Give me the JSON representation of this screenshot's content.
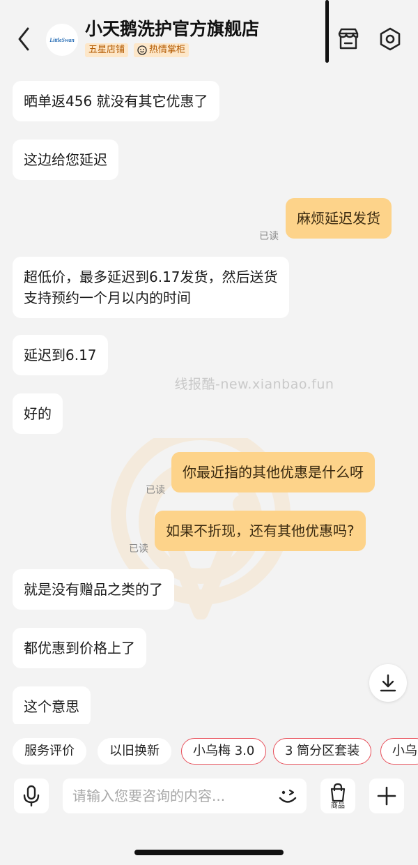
{
  "header": {
    "shop_name": "小天鹅洗护官方旗舰店",
    "logo_text": "LittleSwan",
    "badge_rating": "五星店铺",
    "badge_service": "热情掌柜",
    "icons": [
      "chevron-left-icon",
      "store-icon",
      "settings-icon"
    ]
  },
  "messages": [
    {
      "side": "in",
      "text": "晒单返456   就没有其它优惠了"
    },
    {
      "side": "in",
      "text": "这边给您延迟"
    },
    {
      "side": "out",
      "text": "麻烦延迟发货",
      "status": "已读"
    },
    {
      "side": "in",
      "text": "超低价，最多延迟到6.17发货，然后送货",
      "text2": "支持预约一个月以内的时间"
    },
    {
      "side": "in",
      "text": "延迟到6.17"
    },
    {
      "side": "in",
      "text": "好的"
    },
    {
      "side": "out",
      "text": "你最近指的其他优惠是什么呀",
      "status": "已读"
    },
    {
      "side": "out",
      "text": "如果不折现，还有其他优惠吗?",
      "status": "已读"
    },
    {
      "side": "in",
      "text": "就是没有赠品之类的了"
    },
    {
      "side": "in",
      "text": "都优惠到价格上了"
    },
    {
      "side": "in",
      "text": "这个意思"
    }
  ],
  "watermark": "线报酷-new.xianbao.fun",
  "quick_chips": [
    {
      "label": "服务评价",
      "style": "plain"
    },
    {
      "label": "以旧换新",
      "style": "plain"
    },
    {
      "label": "小乌梅 3.0",
      "style": "hot"
    },
    {
      "label": "3 筒分区套装",
      "style": "hot"
    },
    {
      "label": "小乌",
      "style": "hot"
    }
  ],
  "input": {
    "placeholder": "请输入您要咨询的内容...",
    "goods_label": "商品"
  },
  "colors": {
    "background": "#f3f3f3",
    "incoming_bubble": "#ffffff",
    "outgoing_bubble": "#fdd38a",
    "badge_bg": "#fde7c9",
    "badge_text": "#b35a00",
    "chip_accent": "#e8505b"
  }
}
